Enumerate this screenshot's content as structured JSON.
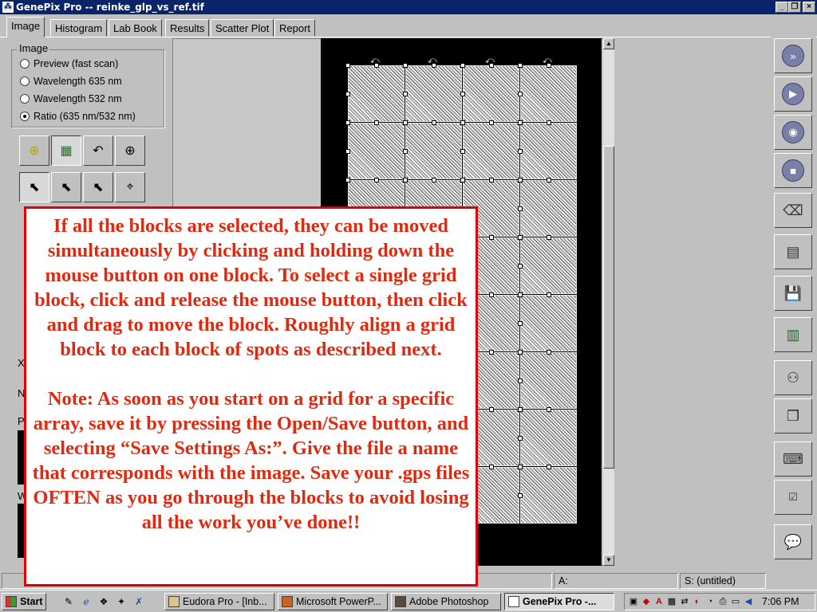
{
  "window": {
    "title": "GenePix Pro -- reinke_glp_vs_ref.tif"
  },
  "tabs": [
    {
      "label": "Image",
      "active": true
    },
    {
      "label": "Histogram"
    },
    {
      "label": "Lab Book"
    },
    {
      "label": "Results"
    },
    {
      "label": "Scatter Plot"
    },
    {
      "label": "Report"
    }
  ],
  "image_group": {
    "label": "Image",
    "options": [
      {
        "label": "Preview (fast scan)",
        "selected": false
      },
      {
        "label": "Wavelength 635 nm",
        "selected": false
      },
      {
        "label": "Wavelength 532 nm",
        "selected": false
      },
      {
        "label": "Ratio (635 nm/532 nm)",
        "selected": true
      }
    ]
  },
  "left_partial_labels": [
    "X",
    "N",
    "P",
    "W"
  ],
  "note": {
    "paragraph1": "If all the blocks are selected, they can be moved simultaneously by clicking and holding down the mouse button on one block.  To select a single grid block, click and release the mouse button, then click and drag to move the block.  Roughly align a grid block to each block of spots as described next.",
    "paragraph2": "Note:  As soon as you start on a grid for a specific array, save it by pressing the Open/Save button, and selecting “Save Settings As:”.  Give the file a name that corresponds with the image.  Save your .gps files OFTEN as you go through the blocks to avoid losing all the work you’ve done!!"
  },
  "status": {
    "a_label": "A:",
    "settings_label": "S: (untitled)"
  },
  "taskbar": {
    "start": "Start",
    "tasks": [
      {
        "label": "Eudora Pro - [Inb..."
      },
      {
        "label": "Microsoft PowerP..."
      },
      {
        "label": "Adobe Photoshop"
      },
      {
        "label": "GenePix Pro -...",
        "active": true
      }
    ],
    "clock": "7:06 PM"
  },
  "colors": {
    "title_bar": "#0a246a",
    "note_text": "#e02a10",
    "note_border": "#e00000"
  }
}
